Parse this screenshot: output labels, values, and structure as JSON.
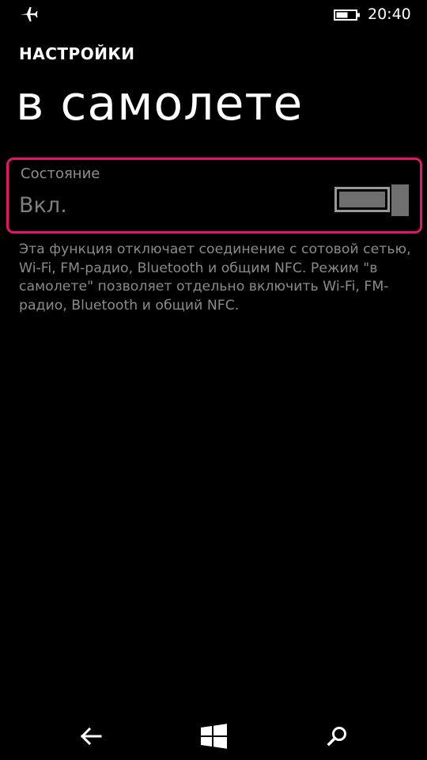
{
  "status_bar": {
    "time": "20:40",
    "airplane_icon": "airplane-icon",
    "battery_icon": "battery-icon"
  },
  "header": {
    "app_title": "НАСТРОЙКИ",
    "page_title": "в самолете"
  },
  "setting": {
    "label": "Состояние",
    "value": "Вкл.",
    "toggle_on": true,
    "highlight_color": "#e5136b"
  },
  "description": "Эта функция отключает соединение с сотовой сетью, Wi-Fi, FM-радио, Bluetooth и общим NFC. Режим \"в самолете\" позволяет отдельно включить Wi-Fi, FM-радио, Bluetooth и общий NFC.",
  "nav_bar": {
    "back_icon": "back-arrow-icon",
    "start_icon": "windows-logo-icon",
    "search_icon": "search-icon"
  }
}
